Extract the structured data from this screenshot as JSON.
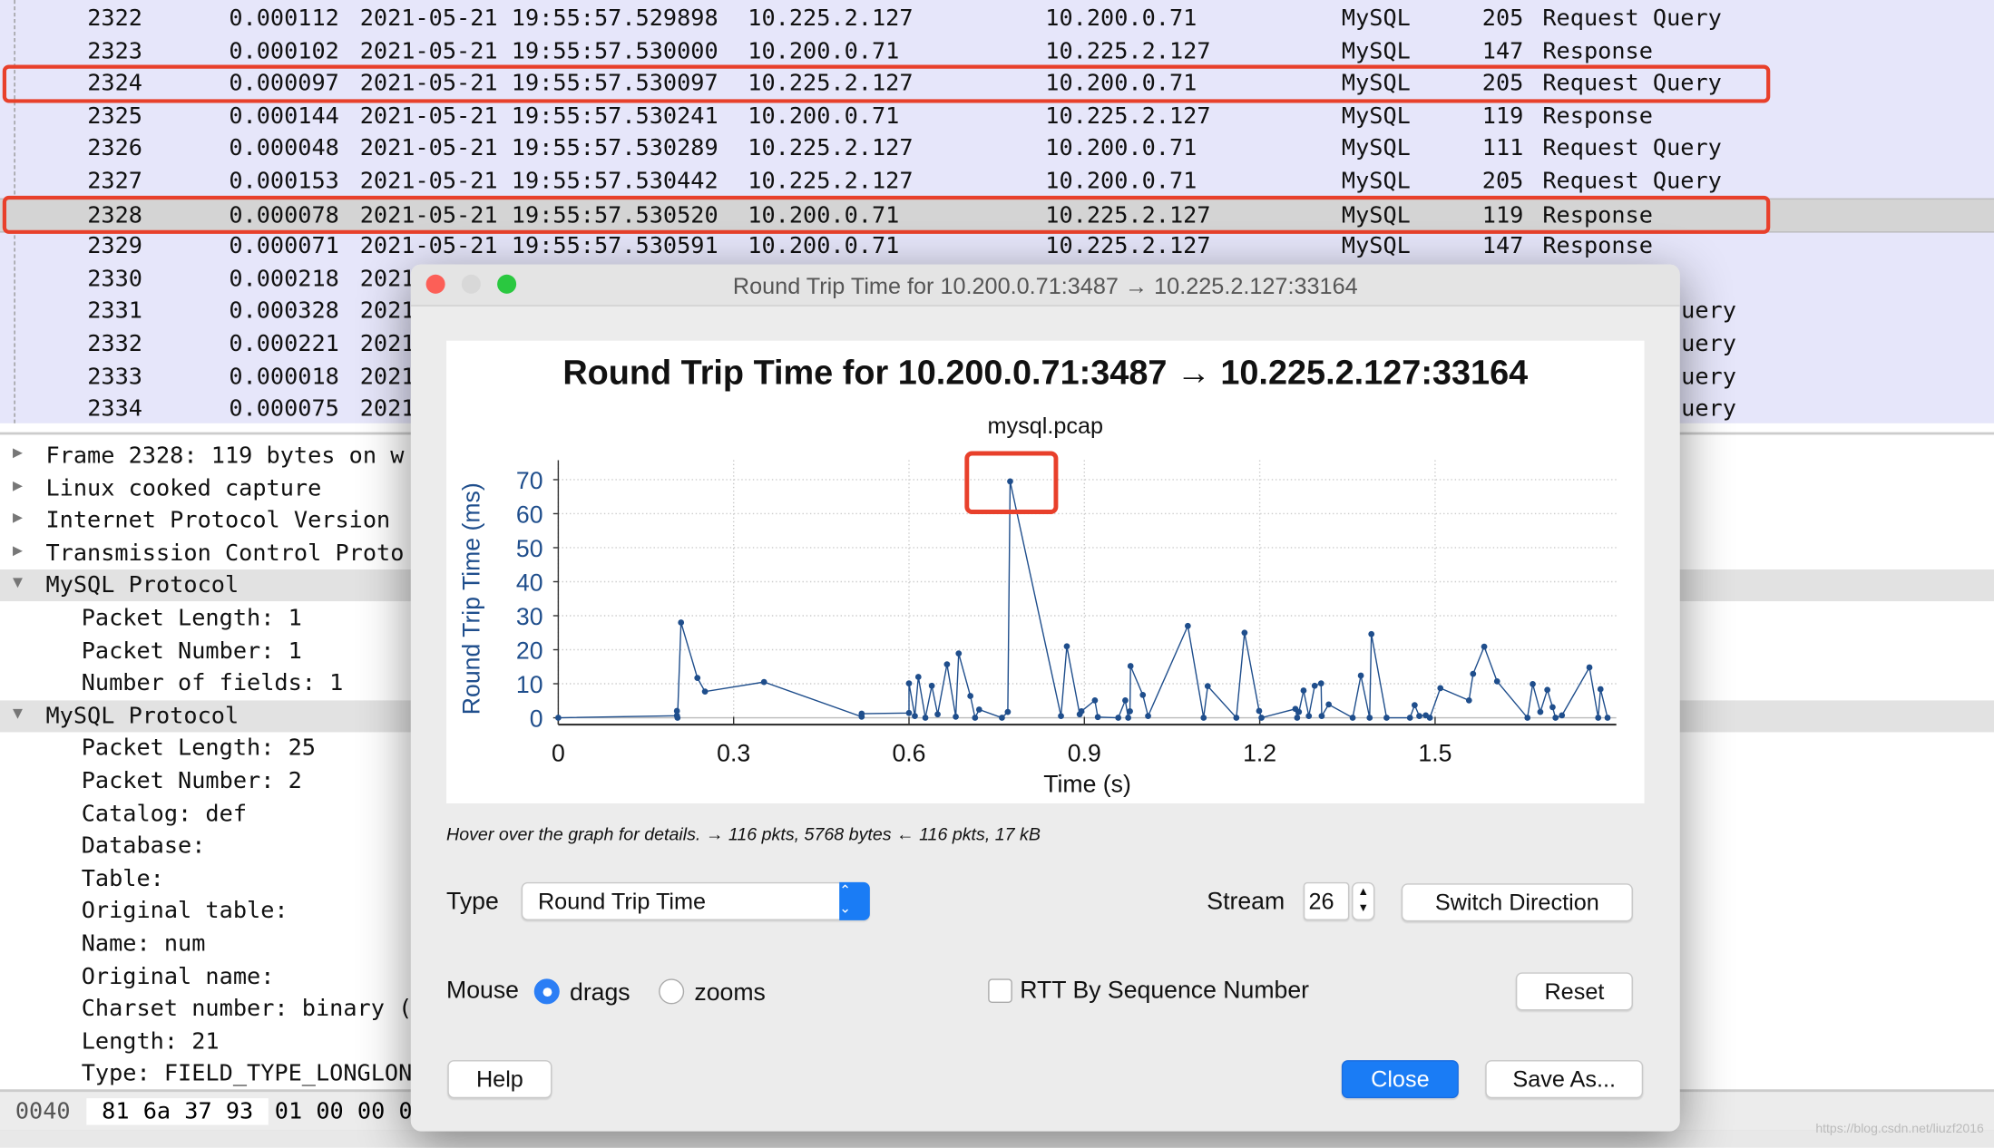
{
  "packets": [
    {
      "no": "2322",
      "time": "0.000112",
      "date": "2021-05-21 19:55:57.529898",
      "src": "10.225.2.127",
      "dst": "10.200.0.71",
      "proto": "MySQL",
      "len": "205",
      "info": "Request Query"
    },
    {
      "no": "2323",
      "time": "0.000102",
      "date": "2021-05-21 19:55:57.530000",
      "src": "10.200.0.71",
      "dst": "10.225.2.127",
      "proto": "MySQL",
      "len": "147",
      "info": "Response"
    },
    {
      "no": "2324",
      "time": "0.000097",
      "date": "2021-05-21 19:55:57.530097",
      "src": "10.225.2.127",
      "dst": "10.200.0.71",
      "proto": "MySQL",
      "len": "205",
      "info": "Request Query"
    },
    {
      "no": "2325",
      "time": "0.000144",
      "date": "2021-05-21 19:55:57.530241",
      "src": "10.200.0.71",
      "dst": "10.225.2.127",
      "proto": "MySQL",
      "len": "119",
      "info": "Response"
    },
    {
      "no": "2326",
      "time": "0.000048",
      "date": "2021-05-21 19:55:57.530289",
      "src": "10.225.2.127",
      "dst": "10.200.0.71",
      "proto": "MySQL",
      "len": "111",
      "info": "Request Query"
    },
    {
      "no": "2327",
      "time": "0.000153",
      "date": "2021-05-21 19:55:57.530442",
      "src": "10.225.2.127",
      "dst": "10.200.0.71",
      "proto": "MySQL",
      "len": "205",
      "info": "Request Query"
    },
    {
      "no": "2328",
      "time": "0.000078",
      "date": "2021-05-21 19:55:57.530520",
      "src": "10.200.0.71",
      "dst": "10.225.2.127",
      "proto": "MySQL",
      "len": "119",
      "info": "Response"
    },
    {
      "no": "2329",
      "time": "0.000071",
      "date": "2021-05-21 19:55:57.530591",
      "src": "10.200.0.71",
      "dst": "10.225.2.127",
      "proto": "MySQL",
      "len": "147",
      "info": "Response"
    },
    {
      "no": "2330",
      "time": "0.000218",
      "date": "2021",
      "info": ""
    },
    {
      "no": "2331",
      "time": "0.000328",
      "date": "2021",
      "info": "uery"
    },
    {
      "no": "2332",
      "time": "0.000221",
      "date": "2021",
      "info": "uery"
    },
    {
      "no": "2333",
      "time": "0.000018",
      "date": "2021",
      "info": "uery"
    },
    {
      "no": "2334",
      "time": "0.000075",
      "date": "2021",
      "info": "uery"
    }
  ],
  "tree": [
    {
      "text": "Frame 2328: 119 bytes on w",
      "level": 0,
      "arrow": "▶"
    },
    {
      "text": "Linux cooked capture",
      "level": 0,
      "arrow": "▶"
    },
    {
      "text": "Internet Protocol Version",
      "level": 0,
      "arrow": "▶"
    },
    {
      "text": "Transmission Control Proto",
      "level": 0,
      "arrow": "▶"
    },
    {
      "text": "MySQL Protocol",
      "level": 0,
      "arrow": "▼",
      "hl": true
    },
    {
      "text": "Packet Length: 1",
      "level": 1
    },
    {
      "text": "Packet Number: 1",
      "level": 1
    },
    {
      "text": "Number of fields: 1",
      "level": 1
    },
    {
      "text": "MySQL Protocol",
      "level": 0,
      "arrow": "▼",
      "hl": true
    },
    {
      "text": "Packet Length: 25",
      "level": 1
    },
    {
      "text": "Packet Number: 2",
      "level": 1
    },
    {
      "text": "Catalog: def",
      "level": 1
    },
    {
      "text": "Database:",
      "level": 1
    },
    {
      "text": "Table:",
      "level": 1
    },
    {
      "text": "Original table:",
      "level": 1
    },
    {
      "text": "Name: num",
      "level": 1
    },
    {
      "text": "Original name:",
      "level": 1
    },
    {
      "text": "Charset number: binary (",
      "level": 1
    },
    {
      "text": "Length: 21",
      "level": 1
    },
    {
      "text": "Type: FIELD_TYPE_LONGLON",
      "level": 1
    }
  ],
  "hex": {
    "offset": "0040",
    "bytes_sel": "81 6a 37 93",
    "bytes": "01 00 00 0"
  },
  "watermark": "https://blog.csdn.net/liuzf2016",
  "dialog": {
    "window_title": "Round Trip Time for 10.200.0.71:3487 → 10.225.2.127:33164",
    "hover_text": "Hover over the graph for details. → 116 pkts, 5768 bytes ← 116 pkts, 17 kB",
    "type_label": "Type",
    "type_value": "Round Trip Time",
    "stream_label": "Stream",
    "stream_value": "26",
    "switch_direction": "Switch Direction",
    "mouse_label": "Mouse",
    "drags": "drags",
    "zooms": "zooms",
    "mouse_mode": "drags",
    "rtt_by_seq": "RTT By Sequence Number",
    "rtt_by_seq_checked": false,
    "reset": "Reset",
    "help": "Help",
    "close": "Close",
    "save_as": "Save As..."
  },
  "colors": {
    "series": "#1f4e8c",
    "highlight_box": "#e8402b",
    "primary_button": "#1a7cf5",
    "packet_list_bg": "#e6e6fa"
  },
  "chart_data": {
    "type": "line",
    "title": "Round Trip Time for 10.200.0.71:3487 → 10.225.2.127:33164",
    "subtitle": "mysql.pcap",
    "xlabel": "Time (s)",
    "ylabel": "Round Trip Time (ms)",
    "xlim": [
      0,
      1.81
    ],
    "ylim": [
      -2,
      72
    ],
    "xticks": [
      "0",
      "0.3",
      "0.6",
      "0.9",
      "1.2",
      "1.5"
    ],
    "yticks": [
      "0",
      "10",
      "20",
      "30",
      "40",
      "50",
      "60",
      "70"
    ],
    "grid": true,
    "points": [
      [
        0,
        0
      ],
      [
        0.203,
        0.6
      ],
      [
        0.203,
        2
      ],
      [
        0.204,
        0
      ],
      [
        0.21,
        28
      ],
      [
        0.238,
        11.7
      ],
      [
        0.251,
        7.7
      ],
      [
        0.352,
        10.5
      ],
      [
        0.519,
        0.3
      ],
      [
        0.519,
        1.2
      ],
      [
        0.6,
        1.4
      ],
      [
        0.6,
        10.1
      ],
      [
        0.61,
        0.5
      ],
      [
        0.616,
        12
      ],
      [
        0.628,
        0
      ],
      [
        0.639,
        9.4
      ],
      [
        0.649,
        1
      ],
      [
        0.665,
        15.7
      ],
      [
        0.68,
        0.3
      ],
      [
        0.685,
        18.9
      ],
      [
        0.705,
        6.4
      ],
      [
        0.713,
        0
      ],
      [
        0.72,
        2.4
      ],
      [
        0.759,
        0
      ],
      [
        0.769,
        1.7
      ],
      [
        0.773,
        69.5
      ],
      [
        0.86,
        0.5
      ],
      [
        0.87,
        21
      ],
      [
        0.892,
        1
      ],
      [
        0.895,
        1.9
      ],
      [
        0.918,
        5.1
      ],
      [
        0.923,
        0.2
      ],
      [
        0.958,
        0
      ],
      [
        0.97,
        5.1
      ],
      [
        0.975,
        0
      ],
      [
        0.978,
        1.9
      ],
      [
        0.979,
        15.2
      ],
      [
        1.0,
        6.7
      ],
      [
        1.009,
        0.5
      ],
      [
        1.077,
        27
      ],
      [
        1.104,
        0
      ],
      [
        1.111,
        9.3
      ],
      [
        1.16,
        0
      ],
      [
        1.174,
        25
      ],
      [
        1.199,
        2
      ],
      [
        1.203,
        0
      ],
      [
        1.261,
        2.6
      ],
      [
        1.264,
        0
      ],
      [
        1.267,
        1.7
      ],
      [
        1.275,
        8
      ],
      [
        1.284,
        0.5
      ],
      [
        1.294,
        9.4
      ],
      [
        1.305,
        10.1
      ],
      [
        1.306,
        0.5
      ],
      [
        1.318,
        3.9
      ],
      [
        1.359,
        0
      ],
      [
        1.373,
        12.4
      ],
      [
        1.388,
        0
      ],
      [
        1.391,
        24.6
      ],
      [
        1.417,
        0
      ],
      [
        1.457,
        0
      ],
      [
        1.465,
        3.7
      ],
      [
        1.473,
        0.5
      ],
      [
        1.484,
        0.7
      ],
      [
        1.491,
        0
      ],
      [
        1.509,
        8.7
      ],
      [
        1.558,
        5.1
      ],
      [
        1.565,
        12.9
      ],
      [
        1.584,
        20.9
      ],
      [
        1.606,
        10.7
      ],
      [
        1.658,
        0
      ],
      [
        1.667,
        9.9
      ],
      [
        1.68,
        1.7
      ],
      [
        1.692,
        8.2
      ],
      [
        1.701,
        3.1
      ],
      [
        1.706,
        0
      ],
      [
        1.717,
        0.7
      ],
      [
        1.764,
        14.8
      ],
      [
        1.779,
        0
      ],
      [
        1.783,
        8.4
      ],
      [
        1.795,
        0
      ]
    ],
    "annotation": "red box around 69.5 ms peak"
  }
}
